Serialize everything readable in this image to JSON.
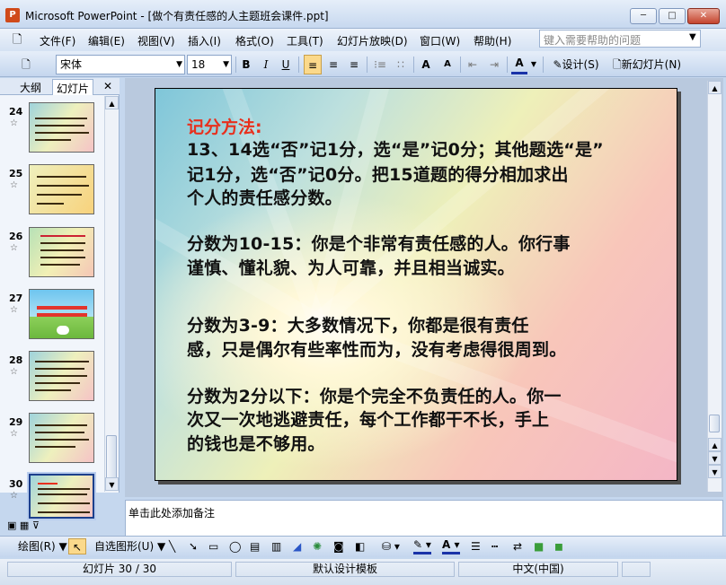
{
  "window": {
    "title": "Microsoft PowerPoint - [做个有责任感的人主题班会课件.ppt]",
    "min": "─",
    "max": "□",
    "close": "✕"
  },
  "menu": {
    "file": "文件(F)",
    "edit": "编辑(E)",
    "view": "视图(V)",
    "insert": "插入(I)",
    "format": "格式(O)",
    "tools": "工具(T)",
    "slideshow": "幻灯片放映(D)",
    "window": "窗口(W)",
    "help": "帮助(H)"
  },
  "help_placeholder": "键入需要帮助的问题",
  "toolbar": {
    "font": "宋体",
    "size": "18",
    "bold": "B",
    "italic": "I",
    "underline": "U",
    "design": "设计(S)",
    "new_slide": "新幻灯片(N)",
    "grow": "A",
    "color": "A"
  },
  "panel": {
    "tab_outline": "大纲",
    "tab_slides": "幻灯片",
    "close": "✕"
  },
  "thumbs": [
    {
      "num": "24"
    },
    {
      "num": "25"
    },
    {
      "num": "26"
    },
    {
      "num": "27"
    },
    {
      "num": "28"
    },
    {
      "num": "29"
    },
    {
      "num": "30"
    }
  ],
  "slide": {
    "title": "记分方法:",
    "lines": [
      "13、14选“否”记1分，选“是”记0分；其他题选“是”",
      "记1分，选“否”记0分。把15道题的得分相加求出",
      "个人的责任感分数。",
      "分数为10-15：你是个非常有责任感的人。你行事",
      "谨慎、懂礼貌、为人可靠，并且相当诚实。",
      "分数为3-9：大多数情况下，你都是很有责任",
      "感，只是偶尔有些率性而为，没有考虑得很周到。",
      "分数为2分以下：你是个完全不负责任的人。你一",
      "次又一次地逃避责任，每个工作都干不长，手上",
      "的钱也是不够用。"
    ]
  },
  "notes_placeholder": "单击此处添加备注",
  "drawing": {
    "draw": "绘图(R)",
    "autoshapes": "自选图形(U)"
  },
  "status": {
    "slide": "幻灯片 30 / 30",
    "template": "默认设计模板",
    "language": "中文(中国)"
  },
  "colors": {
    "title_red": "#e8301d",
    "selected_thumb": "#1c3f8c"
  }
}
